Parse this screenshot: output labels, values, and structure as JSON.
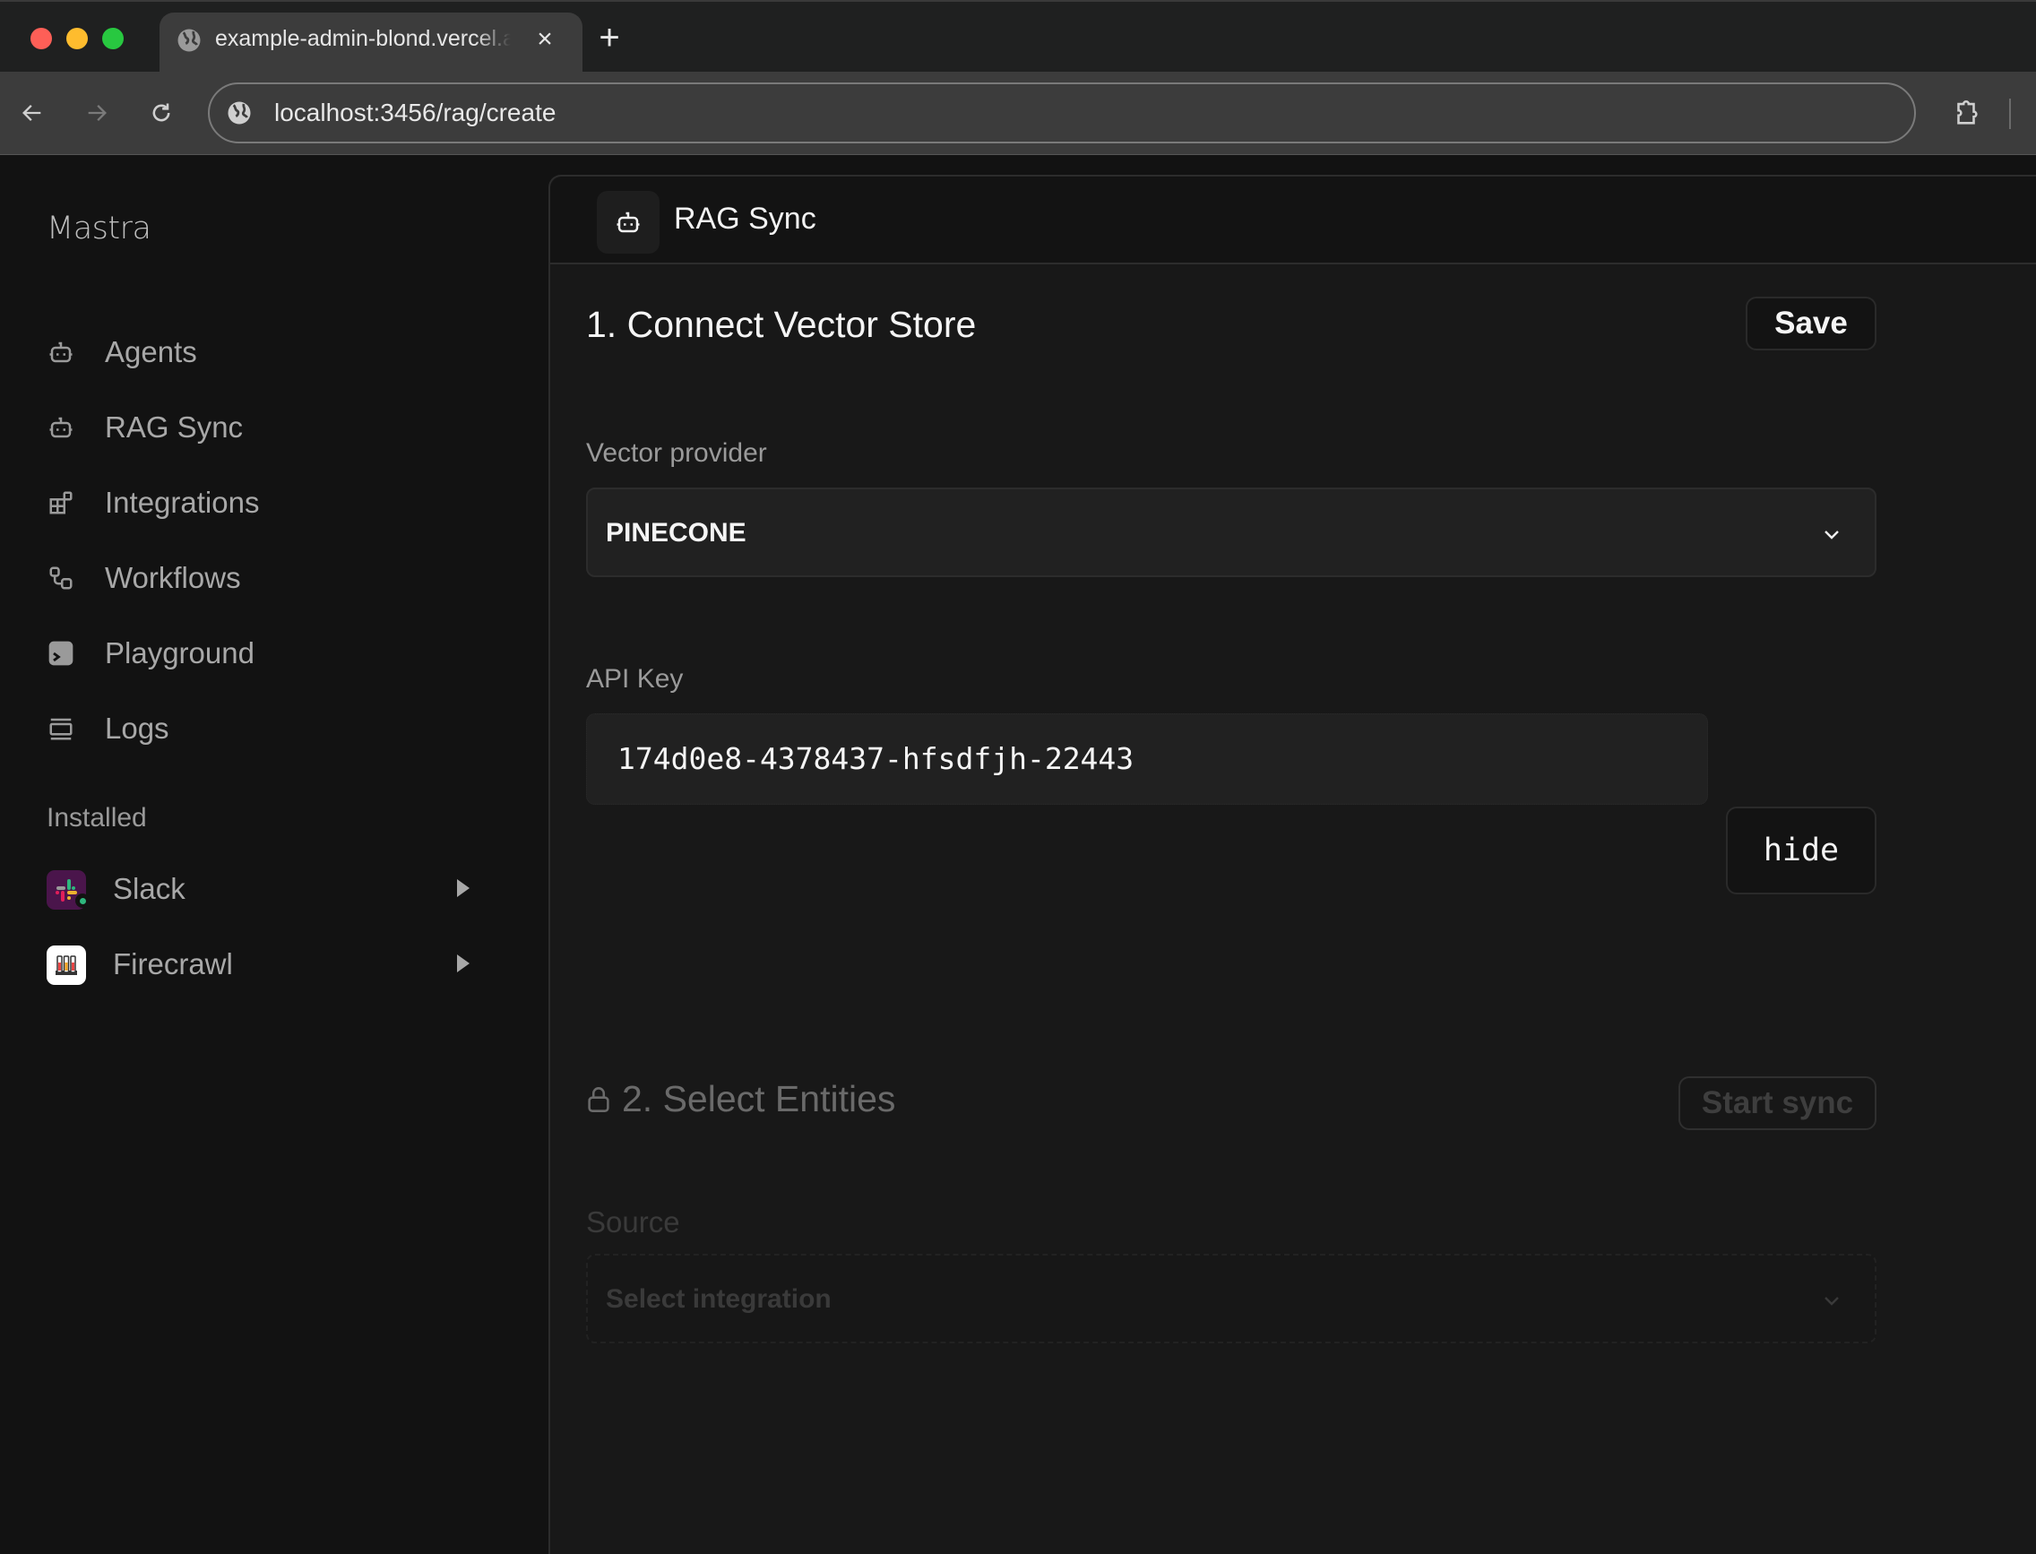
{
  "browser": {
    "tab_title": "example-admin-blond.vercel.app",
    "url": "localhost:3456/rag/create",
    "new_tab_label": "+",
    "close_tab_label": "×"
  },
  "sidebar": {
    "brand": "Mastra",
    "items": [
      {
        "label": "Agents",
        "icon": "robot-icon"
      },
      {
        "label": "RAG Sync",
        "icon": "robot-icon"
      },
      {
        "label": "Integrations",
        "icon": "blocks-icon"
      },
      {
        "label": "Workflows",
        "icon": "workflow-icon"
      },
      {
        "label": "Playground",
        "icon": "terminal-icon"
      },
      {
        "label": "Logs",
        "icon": "logs-icon"
      }
    ],
    "installed_label": "Installed",
    "installed": [
      {
        "label": "Slack",
        "icon": "slack-logo",
        "status": "connected",
        "status_color": "#2eb67d"
      },
      {
        "label": "Firecrawl",
        "icon": "firecrawl-logo"
      }
    ]
  },
  "main": {
    "header_title": "RAG Sync",
    "step1": {
      "title": "1. Connect Vector Store",
      "save_label": "Save",
      "provider_label": "Vector provider",
      "provider_value": "PINECONE",
      "api_key_label": "API Key",
      "api_key_value": "174d0e8-4378437-hfsdfjh-22443",
      "hide_label": "hide"
    },
    "step2": {
      "title": "2. Select Entities",
      "locked": true,
      "start_sync_label": "Start sync",
      "source_label": "Source",
      "source_placeholder": "Select integration"
    }
  }
}
